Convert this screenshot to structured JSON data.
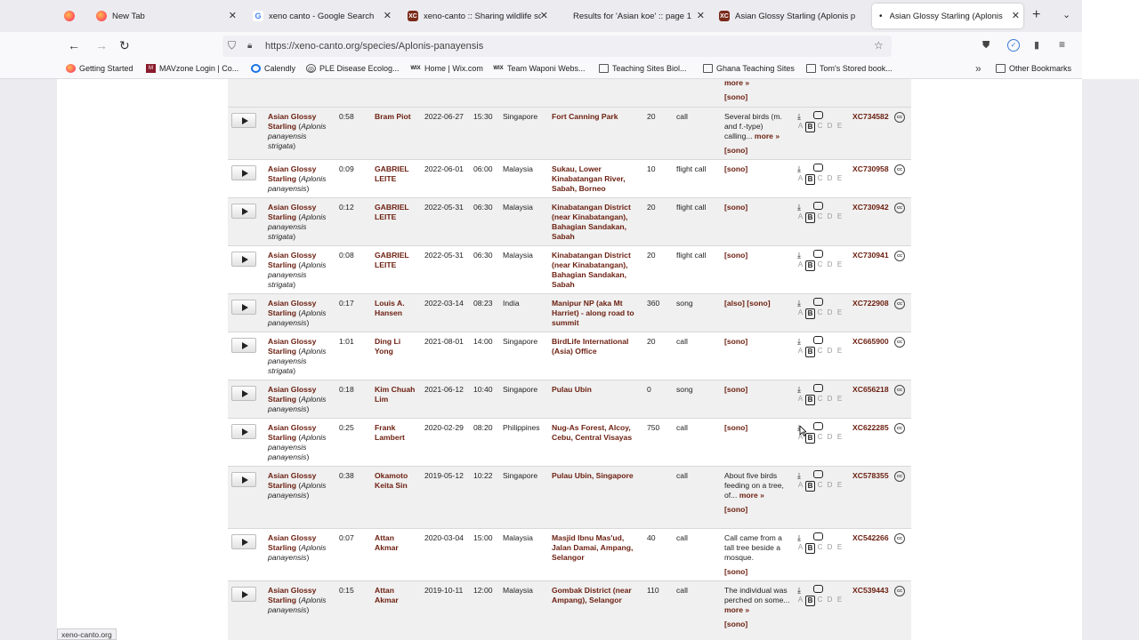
{
  "browser": {
    "tabs": [
      {
        "label": "",
        "fav": "firefox"
      },
      {
        "label": "New Tab",
        "fav": "firefox"
      },
      {
        "label": "xeno canto - Google Search",
        "fav": "google"
      },
      {
        "label": "xeno-canto :: Sharing wildlife sc",
        "fav": "xc"
      },
      {
        "label": "Results for 'Asian koe' :: page 1",
        "fav": "none"
      },
      {
        "label": "Asian Glossy Starling (Aplonis p",
        "fav": "xc"
      },
      {
        "label": "Asian Glossy Starling (Aplonis p",
        "fav": "dot",
        "active": true
      }
    ],
    "url": "https://xeno-canto.org/species/Aplonis-panayensis",
    "bookmarks": [
      {
        "label": "Getting Started",
        "icon": "firefox-icon"
      },
      {
        "label": "MAVzone Login | Co...",
        "icon": "mav-icon"
      },
      {
        "label": "Calendly",
        "icon": "calendly-icon"
      },
      {
        "label": "PLE Disease Ecolog...",
        "icon": "globe-icon"
      },
      {
        "label": "Home | Wix.com",
        "icon": "wix-icon"
      },
      {
        "label": "Team Waponi Webs...",
        "icon": "wix-icon"
      },
      {
        "label": "Teaching Sites Biol...",
        "icon": "folder-icon"
      },
      {
        "label": "Ghana Teaching Sites",
        "icon": "folder-icon"
      },
      {
        "label": "Tom's Stored book...",
        "icon": "folder-icon"
      }
    ],
    "other_bookmarks": "Other Bookmarks",
    "status_url": "xeno-canto.org"
  },
  "table": {
    "top_fragment": {
      "more": "more »",
      "sono": "[sono]"
    },
    "rows": [
      {
        "common": "Asian Glossy Starling",
        "sci1": "Aplonis",
        "sci2": "panayensis strigata",
        "length": "0:58",
        "recordist": "Bram Piot",
        "date": "2022-06-27",
        "time": "15:30",
        "country": "Singapore",
        "location": "Fort Canning Park",
        "elev": "20",
        "type": "call",
        "remarks": "Several birds (m. and f.-type) calling...",
        "more": "more »",
        "sono": "[sono]",
        "grade": "B",
        "xc": "XC734582"
      },
      {
        "common": "Asian Glossy Starling",
        "sci1": "Aplonis",
        "sci2": "panayensis",
        "length": "0:09",
        "recordist": "GABRIEL LEITE",
        "date": "2022-06-01",
        "time": "06:00",
        "country": "Malaysia",
        "location": "Sukau, Lower Kinabatangan River, Sabah, Borneo",
        "elev": "10",
        "type": "flight call",
        "remarks": "",
        "more": "",
        "sono": "[sono]",
        "grade": "B",
        "xc": "XC730958"
      },
      {
        "common": "Asian Glossy Starling",
        "sci1": "Aplonis",
        "sci2": "panayensis strigata",
        "length": "0:12",
        "recordist": "GABRIEL LEITE",
        "date": "2022-05-31",
        "time": "06:30",
        "country": "Malaysia",
        "location": "Kinabatangan District (near Kinabatangan), Bahagian Sandakan, Sabah",
        "elev": "20",
        "type": "flight call",
        "remarks": "",
        "more": "",
        "sono": "[sono]",
        "grade": "B",
        "xc": "XC730942"
      },
      {
        "common": "Asian Glossy Starling",
        "sci1": "Aplonis",
        "sci2": "panayensis strigata",
        "length": "0:08",
        "recordist": "GABRIEL LEITE",
        "date": "2022-05-31",
        "time": "06:30",
        "country": "Malaysia",
        "location": "Kinabatangan District (near Kinabatangan), Bahagian Sandakan, Sabah",
        "elev": "20",
        "type": "flight call",
        "remarks": "",
        "more": "",
        "sono": "[sono]",
        "grade": "B",
        "xc": "XC730941"
      },
      {
        "common": "Asian Glossy Starling",
        "sci1": "Aplonis",
        "sci2": "panayensis",
        "length": "0:17",
        "recordist": "Louis A. Hansen",
        "date": "2022-03-14",
        "time": "08:23",
        "country": "India",
        "location": "Manipur NP (aka Mt Harriet) - along road to summit",
        "elev": "360",
        "type": "song",
        "remarks": "",
        "more": "",
        "sono": "[also] [sono]",
        "grade": "B",
        "xc": "XC722908"
      },
      {
        "common": "Asian Glossy Starling",
        "sci1": "Aplonis",
        "sci2": "panayensis strigata",
        "length": "1:01",
        "recordist": "Ding Li Yong",
        "date": "2021-08-01",
        "time": "14:00",
        "country": "Singapore",
        "location": "BirdLife International (Asia) Office",
        "elev": "20",
        "type": "call",
        "remarks": "",
        "more": "",
        "sono": "[sono]",
        "grade": "B",
        "xc": "XC665900"
      },
      {
        "common": "Asian Glossy Starling",
        "sci1": "Aplonis",
        "sci2": "panayensis",
        "length": "0:18",
        "recordist": "Kim Chuah Lim",
        "date": "2021-06-12",
        "time": "10:40",
        "country": "Singapore",
        "location": "Pulau Ubin",
        "elev": "0",
        "type": "song",
        "remarks": "",
        "more": "",
        "sono": "[sono]",
        "grade": "B",
        "xc": "XC656218"
      },
      {
        "common": "Asian Glossy Starling",
        "sci1": "Aplonis",
        "sci2": "panayensis panayensis",
        "length": "0:25",
        "recordist": "Frank Lambert",
        "date": "2020-02-29",
        "time": "08:20",
        "country": "Philippines",
        "location": "Nug-As Forest, Alcoy, Cebu, Central Visayas",
        "elev": "750",
        "type": "call",
        "remarks": "",
        "more": "",
        "sono": "[sono]",
        "grade": "B",
        "xc": "XC622285"
      },
      {
        "common": "Asian Glossy Starling",
        "sci1": "Aplonis",
        "sci2": "panayensis",
        "length": "0:38",
        "recordist": "Okamoto Keita Sin",
        "date": "2019-05-12",
        "time": "10:22",
        "country": "Singapore",
        "location": "Pulau Ubin, Singapore",
        "elev": "",
        "type": "call",
        "remarks": "About five birds feeding on a tree, of...",
        "more": "more »",
        "sono": "[sono]",
        "grade": "B",
        "xc": "XC578355"
      },
      {
        "common": "Asian Glossy Starling",
        "sci1": "Aplonis",
        "sci2": "panayensis",
        "length": "0:07",
        "recordist": "Attan Akmar",
        "date": "2020-03-04",
        "time": "15:00",
        "country": "Malaysia",
        "location": "Masjid Ibnu Mas'ud, Jalan Damai, Ampang, Selangor",
        "elev": "40",
        "type": "call",
        "remarks": "Call came from a tall tree beside a mosque.",
        "more": "",
        "sono": "[sono]",
        "grade": "B",
        "xc": "XC542266"
      },
      {
        "common": "Asian Glossy Starling",
        "sci1": "Aplonis",
        "sci2": "panayensis",
        "length": "0:15",
        "recordist": "Attan Akmar",
        "date": "2019-10-11",
        "time": "12:00",
        "country": "Malaysia",
        "location": "Gombak District (near Ampang), Selangor",
        "elev": "110",
        "type": "call",
        "remarks": "The individual was perched on some...",
        "more": "more »",
        "sono": "[sono]",
        "grade": "B",
        "xc": "XC539443"
      }
    ]
  }
}
